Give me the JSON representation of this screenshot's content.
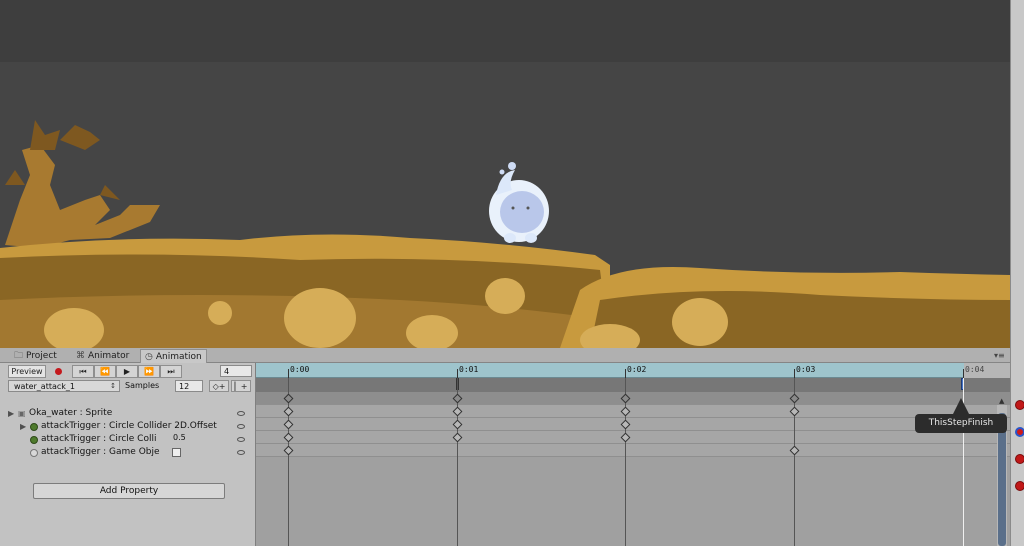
{
  "tabs": [
    {
      "icon": "folder-icon",
      "label": "Project"
    },
    {
      "icon": "animator-icon",
      "label": "Animator"
    },
    {
      "icon": "clock-icon",
      "label": "Animation"
    }
  ],
  "toolbar": {
    "preview_label": "Preview",
    "frame_value": "4",
    "clip_name": "water_attack_1",
    "samples_label": "Samples",
    "samples_value": "12",
    "add_key_icon": "add-keyframe-icon",
    "add_event_icon": "add-event-icon"
  },
  "properties": [
    {
      "label": "Oka_water : Sprite",
      "expanded": false,
      "indent": 0
    },
    {
      "label": "attackTrigger : Circle Collider 2D.Offset",
      "expanded": false,
      "indent": 1
    },
    {
      "label": "attackTrigger : Circle Colli",
      "value": "0.5",
      "indent": 1
    },
    {
      "label": "attackTrigger : Game Obje",
      "checkbox": false,
      "indent": 1
    }
  ],
  "add_property_label": "Add Property",
  "timeline": {
    "ticks": [
      "0:00",
      "0:01",
      "0:02",
      "0:03",
      "0:04"
    ],
    "tooltip": "ThisStepFinish"
  },
  "colors": {
    "ruler": "#9ec4cc",
    "record": "#c4181c",
    "sky": "#3d3d3d",
    "ground": "#c89a3e"
  }
}
